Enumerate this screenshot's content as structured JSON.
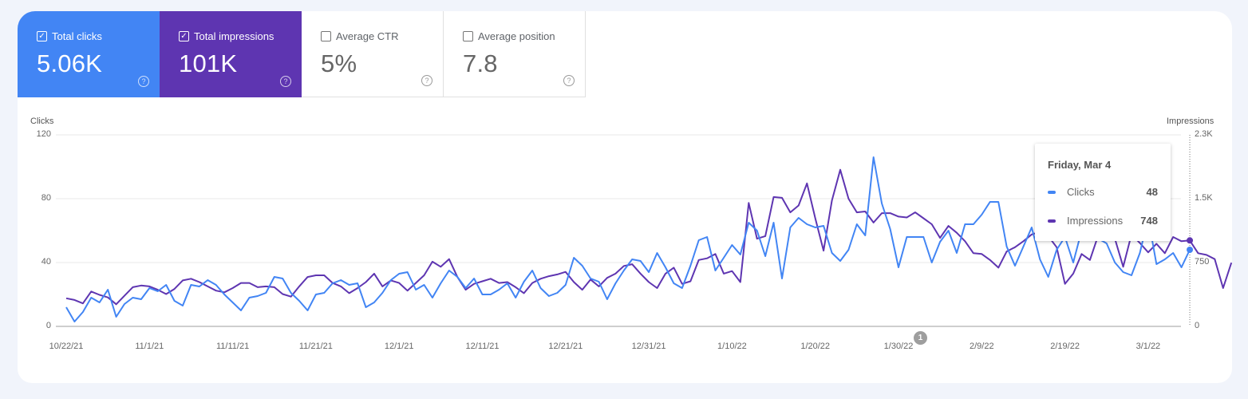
{
  "metrics": [
    {
      "id": "clicks",
      "label": "Total clicks",
      "value": "5.06K",
      "checked": true,
      "color": "#4285f4",
      "help_icon": "help-circle-icon"
    },
    {
      "id": "impressions",
      "label": "Total impressions",
      "value": "101K",
      "checked": true,
      "color": "#5e35b1",
      "help_icon": "help-circle-icon"
    },
    {
      "id": "ctr",
      "label": "Average CTR",
      "value": "5%",
      "checked": false,
      "help_icon": "help-circle-icon"
    },
    {
      "id": "position",
      "label": "Average position",
      "value": "7.8",
      "checked": false,
      "help_icon": "help-circle-icon"
    }
  ],
  "chart_data": {
    "type": "line",
    "start_date": "2021-10-22",
    "end_date": "2022-03-04",
    "x_tick_labels": [
      "10/22/21",
      "11/1/21",
      "11/11/21",
      "11/21/21",
      "12/1/21",
      "12/11/21",
      "12/21/21",
      "12/31/21",
      "1/10/22",
      "1/20/22",
      "1/30/22",
      "2/9/22",
      "2/19/22",
      "3/1/22"
    ],
    "y_left": {
      "label": "Clicks",
      "ticks": [
        "0",
        "40",
        "80",
        "120"
      ],
      "range": [
        0,
        120
      ]
    },
    "y_right": {
      "label": "Impressions",
      "ticks": [
        "0",
        "750",
        "1.5K",
        "2.3K"
      ],
      "range": [
        0,
        2250
      ]
    },
    "grid": true,
    "series": [
      {
        "name": "Clicks",
        "axis": "left",
        "color": "#4285f4",
        "values": [
          12,
          3,
          9,
          18,
          15,
          23,
          6,
          14,
          18,
          17,
          24,
          22,
          26,
          16,
          13,
          26,
          25,
          29,
          26,
          20,
          15,
          10,
          18,
          19,
          21,
          31,
          30,
          21,
          16,
          10,
          20,
          21,
          27,
          29,
          26,
          27,
          12,
          15,
          21,
          29,
          33,
          34,
          23,
          26,
          18,
          27,
          35,
          31,
          24,
          30,
          20,
          20,
          23,
          27,
          18,
          28,
          35,
          24,
          19,
          21,
          26,
          43,
          38,
          30,
          28,
          17,
          27,
          35,
          42,
          41,
          34,
          46,
          37,
          27,
          24,
          38,
          54,
          56,
          35,
          43,
          51,
          45,
          65,
          60,
          44,
          65,
          30,
          62,
          68,
          64,
          62,
          63,
          46,
          41,
          48,
          64,
          57,
          106,
          77,
          61,
          37,
          56,
          56,
          56,
          40,
          53,
          60,
          46,
          64,
          64,
          70,
          78,
          78,
          50,
          38,
          50,
          62,
          42,
          31,
          48,
          56,
          40,
          60,
          70,
          55,
          52,
          40,
          34,
          32,
          46,
          68,
          39,
          42,
          46,
          37,
          48
        ]
      },
      {
        "name": "Impressions",
        "axis": "right",
        "color": "#5e35b1",
        "values": [
          330,
          310,
          270,
          410,
          370,
          340,
          260,
          360,
          460,
          480,
          470,
          430,
          380,
          440,
          540,
          560,
          520,
          470,
          420,
          400,
          450,
          510,
          510,
          460,
          470,
          460,
          380,
          350,
          470,
          580,
          600,
          600,
          510,
          470,
          390,
          450,
          520,
          620,
          470,
          540,
          510,
          420,
          510,
          600,
          760,
          700,
          790,
          580,
          430,
          500,
          530,
          560,
          510,
          520,
          460,
          390,
          510,
          560,
          590,
          610,
          640,
          520,
          430,
          550,
          470,
          570,
          620,
          710,
          730,
          620,
          520,
          450,
          620,
          690,
          500,
          530,
          780,
          800,
          850,
          620,
          650,
          520,
          1450,
          1030,
          1060,
          1520,
          1510,
          1340,
          1420,
          1680,
          1270,
          890,
          1480,
          1840,
          1500,
          1340,
          1350,
          1220,
          1330,
          1330,
          1290,
          1280,
          1340,
          1270,
          1200,
          1040,
          1180,
          1100,
          1000,
          860,
          850,
          780,
          690,
          880,
          930,
          1000,
          1080,
          1110,
          1060,
          930,
          500,
          620,
          850,
          780,
          1070,
          1110,
          1030,
          700,
          1080,
          980,
          870,
          970,
          860,
          1050,
          1000,
          1010,
          860,
          840,
          790,
          450,
          748
        ]
      }
    ],
    "tooltip": {
      "date": "Friday, Mar 4",
      "rows": [
        {
          "label": "Clicks",
          "value": "48"
        },
        {
          "label": "Impressions",
          "value": "748"
        }
      ]
    },
    "annotation_marker": "1"
  }
}
